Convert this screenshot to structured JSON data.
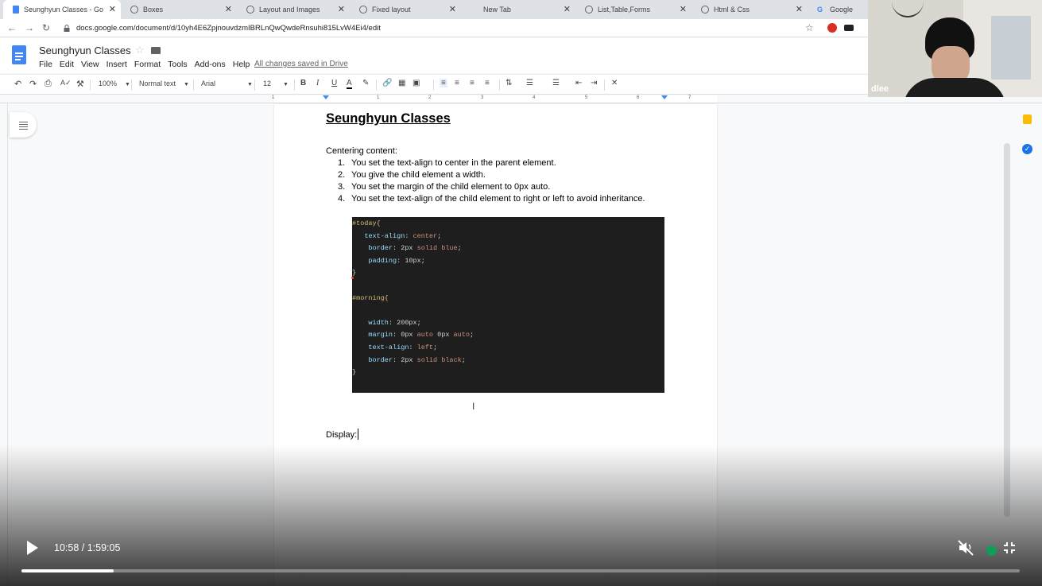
{
  "tabs": [
    {
      "title": "Seunghyun Classes - Goog",
      "active": true,
      "icon": "docs-icon"
    },
    {
      "title": "Boxes",
      "icon": "globe-icon"
    },
    {
      "title": "Layout and Images",
      "icon": "globe-icon"
    },
    {
      "title": "Fixed layout",
      "icon": "globe-icon"
    },
    {
      "title": "New Tab",
      "icon": "none"
    },
    {
      "title": "List,Table,Forms",
      "icon": "globe-icon"
    },
    {
      "title": "Html & Css",
      "icon": "globe-icon"
    },
    {
      "title": "Google",
      "icon": "google-icon"
    }
  ],
  "address": {
    "url": "docs.google.com/document/d/10yh4E6ZpjnouvdzmIBRLnQwQwdeRnsuhi815LvW4Ei4/edit"
  },
  "docs": {
    "title": "Seunghyun Classes",
    "menu": [
      "File",
      "Edit",
      "View",
      "Insert",
      "Format",
      "Tools",
      "Add-ons",
      "Help"
    ],
    "save_status": "All changes saved in Drive"
  },
  "toolbar": {
    "zoom": "100%",
    "style": "Normal text",
    "font": "Arial",
    "size": "12"
  },
  "ruler": {
    "numbers": [
      "1",
      "1",
      "2",
      "3",
      "4",
      "5",
      "6",
      "7"
    ]
  },
  "document": {
    "heading": "Seunghyun Classes",
    "intro": "Centering content:",
    "steps": [
      {
        "num": "1.",
        "text": "You set the text-align to center in the parent element."
      },
      {
        "num": "2.",
        "text": "You give the child element a width."
      },
      {
        "num": "3.",
        "text": "You set the margin of the child element to 0px auto."
      },
      {
        "num": "4.",
        "text": "You set the text-align of the child element to right or left to avoid inheritance."
      }
    ],
    "code": [
      {
        "indent": "",
        "parts": [
          [
            "sel",
            "#today{"
          ]
        ]
      },
      {
        "indent": "   ",
        "parts": [
          [
            "prop",
            "text-align"
          ],
          [
            "pun",
            ": "
          ],
          [
            "val",
            "center"
          ],
          [
            "pun",
            ";"
          ]
        ]
      },
      {
        "indent": "    ",
        "parts": [
          [
            "prop",
            "border"
          ],
          [
            "pun",
            ": "
          ],
          [
            "pun",
            "2px "
          ],
          [
            "val",
            "solid blue"
          ],
          [
            "pun",
            ";"
          ]
        ]
      },
      {
        "indent": "    ",
        "parts": [
          [
            "prop",
            "padding"
          ],
          [
            "pun",
            ": "
          ],
          [
            "pun",
            "10px"
          ],
          [
            "pun",
            ";"
          ]
        ]
      },
      {
        "indent": "",
        "parts": [
          [
            "pun",
            "}"
          ]
        ]
      },
      {
        "indent": "",
        "parts": []
      },
      {
        "indent": "",
        "parts": [
          [
            "sel",
            "#morning{"
          ]
        ]
      },
      {
        "indent": "",
        "parts": []
      },
      {
        "indent": "    ",
        "parts": [
          [
            "prop",
            "width"
          ],
          [
            "pun",
            ": "
          ],
          [
            "pun",
            "200px"
          ],
          [
            "pun",
            ";"
          ]
        ]
      },
      {
        "indent": "    ",
        "parts": [
          [
            "prop",
            "margin"
          ],
          [
            "pun",
            ": "
          ],
          [
            "pun",
            "0px "
          ],
          [
            "val",
            "auto"
          ],
          [
            "pun",
            " 0px "
          ],
          [
            "val",
            "auto"
          ],
          [
            "pun",
            ";"
          ]
        ]
      },
      {
        "indent": "    ",
        "parts": [
          [
            "prop",
            "text-align"
          ],
          [
            "pun",
            ": "
          ],
          [
            "val",
            "left"
          ],
          [
            "pun",
            ";"
          ]
        ]
      },
      {
        "indent": "    ",
        "parts": [
          [
            "prop",
            "border"
          ],
          [
            "pun",
            ": "
          ],
          [
            "pun",
            "2px "
          ],
          [
            "val",
            "solid black"
          ],
          [
            "pun",
            ";"
          ]
        ]
      },
      {
        "indent": "",
        "parts": [
          [
            "pun",
            "}"
          ]
        ]
      }
    ],
    "display_text": "Display:"
  },
  "webcam": {
    "name": "dlee"
  },
  "video": {
    "time": "10:58 / 1:59:05",
    "progress": 0.092
  },
  "colors": {
    "docs_blue": "#4285f4",
    "code_bg": "#1e1e1e",
    "selector": "#d7ba7d",
    "property": "#9cdcfe",
    "value": "#ce9178"
  }
}
